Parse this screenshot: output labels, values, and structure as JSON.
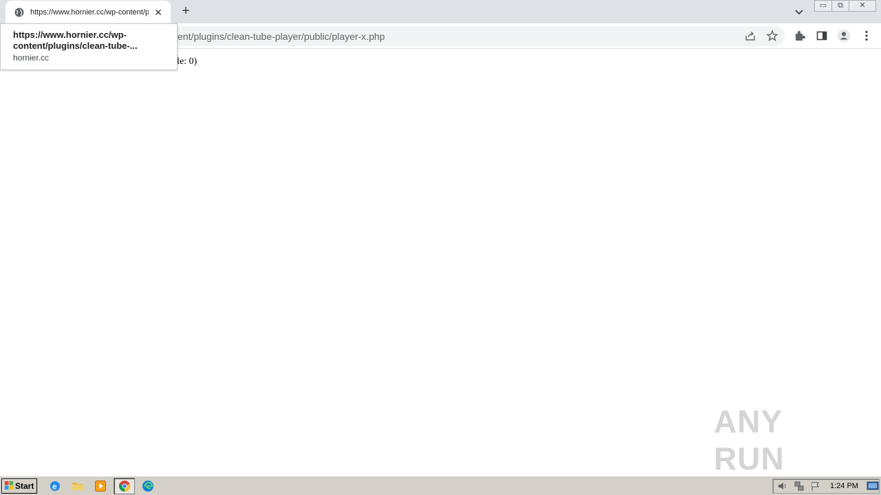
{
  "browser": {
    "tab": {
      "title": "https://www.hornier.cc/wp-content/plugins/clean-tube-player/public/player-x.php"
    },
    "omnibox": {
      "url_visible": "ent/plugins/clean-tube-player/public/player-x.php"
    },
    "tooltip": {
      "url_line1": "https://www.hornier.cc/wp-",
      "url_line2": "content/plugins/clean-tube-...",
      "host": "hornier.cc"
    }
  },
  "page": {
    "text_visible": "le: 0)"
  },
  "watermark": {
    "text": "ANY RUN"
  },
  "taskbar": {
    "start_label": "Start",
    "clock": "1:24 PM"
  },
  "colors": {
    "tabstrip": "#dee1e6",
    "omnibox": "#f1f3f4",
    "taskbar": "#d4d0c8"
  }
}
